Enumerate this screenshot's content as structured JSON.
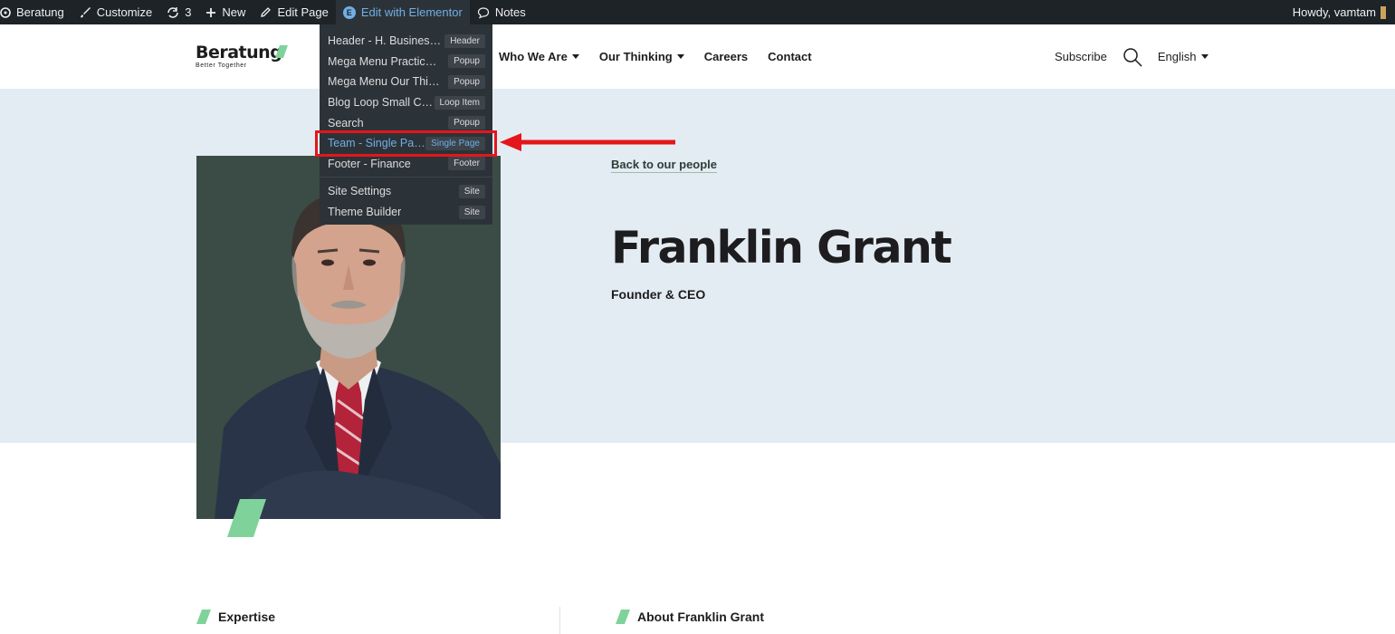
{
  "admin_bar": {
    "site_name": "Beratung",
    "customize": "Customize",
    "updates_count": "3",
    "new": "New",
    "edit_page": "Edit Page",
    "edit_with_elementor": "Edit with Elementor",
    "notes": "Notes",
    "howdy": "Howdy, vamtam"
  },
  "elementor_menu": {
    "items": [
      {
        "label": "Header - H. Business ...",
        "tag": "Header"
      },
      {
        "label": "Mega Menu Practice A...",
        "tag": "Popup"
      },
      {
        "label": "Mega Menu Our Thinki...",
        "tag": "Popup"
      },
      {
        "label": "Blog Loop Small Co...",
        "tag": "Loop Item"
      },
      {
        "label": "Search",
        "tag": "Popup"
      },
      {
        "label": "Team - Single Page",
        "tag": "Single Page"
      },
      {
        "label": "Footer - Finance",
        "tag": "Footer"
      }
    ],
    "site_items": [
      {
        "label": "Site Settings",
        "tag": "Site"
      },
      {
        "label": "Theme Builder",
        "tag": "Site"
      }
    ]
  },
  "header": {
    "logo_text": "Beratung",
    "logo_tagline": "Better Together",
    "nav": [
      "Who We Are",
      "Our Thinking",
      "Careers",
      "Contact"
    ],
    "subscribe": "Subscribe",
    "language": "English"
  },
  "hero": {
    "back_link": "Back to our people",
    "name": "Franklin Grant",
    "role": "Founder & CEO"
  },
  "sections": {
    "expertise": "Expertise",
    "about": "About Franklin Grant"
  },
  "colors": {
    "admin_bar_bg": "#1d2327",
    "hero_bg": "#e4ecf3",
    "accent_green": "#7fd39a",
    "highlight_red": "#e4161b",
    "elementor_blue": "#72aee6"
  }
}
